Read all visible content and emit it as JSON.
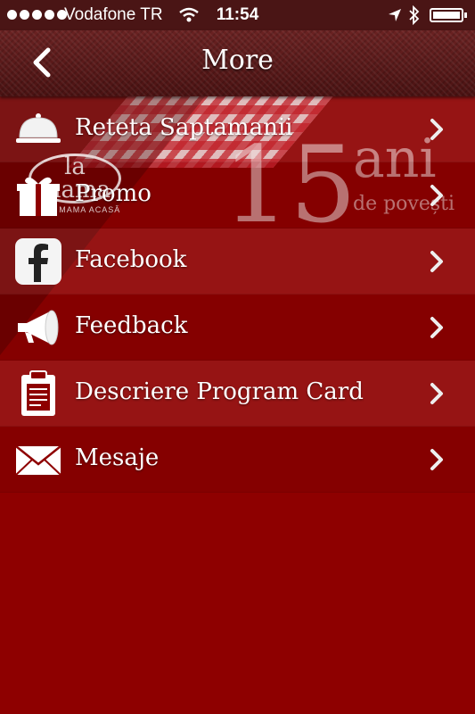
{
  "status_bar": {
    "carrier": "Vodafone TR",
    "time": "11:54",
    "icons": [
      "signal-dots",
      "wifi-icon",
      "location-arrow-icon",
      "bluetooth-icon",
      "battery-icon"
    ]
  },
  "nav": {
    "title": "More",
    "back_icon": "chevron-left-icon"
  },
  "background": {
    "logo_text": "la mama",
    "logo_tagline": "CA LA MAMA ACASĂ",
    "anniversary_number": "15",
    "anniversary_word": "ani",
    "anniversary_subtitle": "de povești"
  },
  "menu": {
    "items": [
      {
        "label": "Reteta Saptamanii",
        "icon": "cloche-icon"
      },
      {
        "label": "Promo",
        "icon": "gift-icon"
      },
      {
        "label": "Facebook",
        "icon": "facebook-icon"
      },
      {
        "label": "Feedback",
        "icon": "megaphone-icon"
      },
      {
        "label": "Descriere Program Card",
        "icon": "clipboard-icon"
      },
      {
        "label": "Mesaje",
        "icon": "envelope-icon"
      }
    ]
  },
  "colors": {
    "background": "#8e0000",
    "nav_bar": "#5a1a1a",
    "text": "#ffffff"
  }
}
